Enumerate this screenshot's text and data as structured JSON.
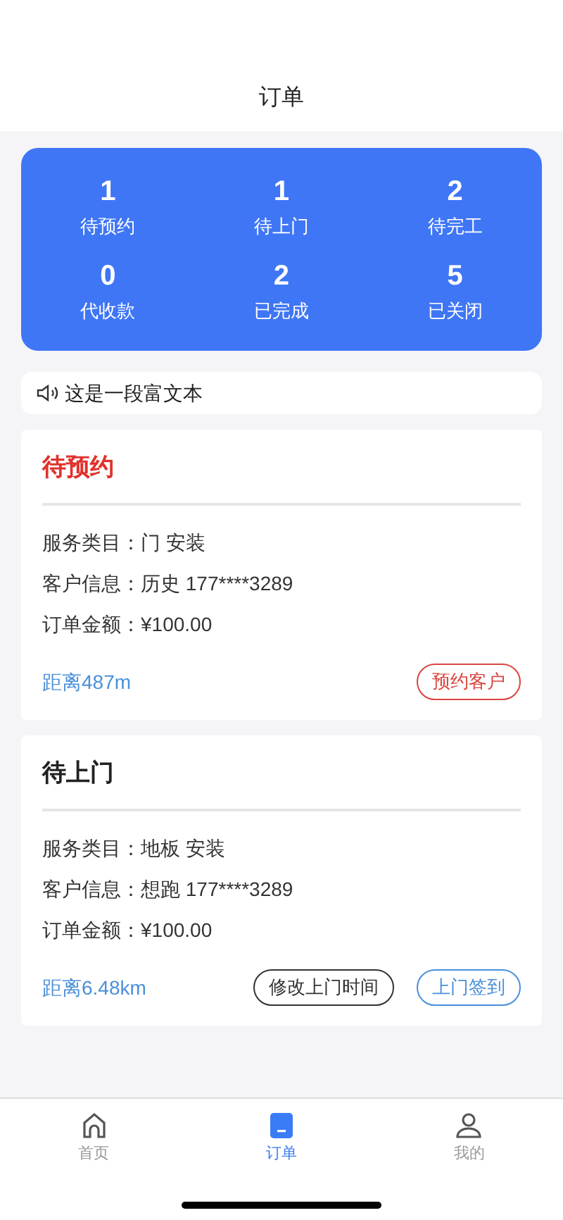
{
  "header": {
    "title": "订单"
  },
  "stats": [
    {
      "count": "1",
      "label": "待预约"
    },
    {
      "count": "1",
      "label": "待上门"
    },
    {
      "count": "2",
      "label": "待完工"
    },
    {
      "count": "0",
      "label": "代收款"
    },
    {
      "count": "2",
      "label": "已完成"
    },
    {
      "count": "5",
      "label": "已关闭"
    }
  ],
  "notice": {
    "text": "这是一段富文本"
  },
  "orders": [
    {
      "status": "待预约",
      "color": "#e0322c",
      "fields": [
        {
          "label": "服务类目：",
          "value": "门 安装"
        },
        {
          "label": "客户信息：",
          "value": "历史 177****3289"
        },
        {
          "label": "订单金额：",
          "value": "¥100.00"
        }
      ],
      "distance": "距离487m",
      "actions": [
        {
          "label": "预约客户",
          "color": "#d9453f"
        }
      ]
    },
    {
      "status": "待上门",
      "color": "#222222",
      "fields": [
        {
          "label": "服务类目：",
          "value": "地板 安装"
        },
        {
          "label": "客户信息：",
          "value": "想跑 177****3289"
        },
        {
          "label": "订单金额：",
          "value": "¥100.00"
        }
      ],
      "distance": "距离6.48km",
      "actions": [
        {
          "label": "修改上门时间",
          "color": "#333333"
        },
        {
          "label": "上门签到",
          "color": "#4a90d9"
        }
      ]
    }
  ],
  "tabbar": [
    {
      "label": "首页",
      "kind": "home",
      "selected": false
    },
    {
      "label": "订单",
      "kind": "orders",
      "selected": true
    },
    {
      "label": "我的",
      "kind": "profile",
      "selected": false
    }
  ]
}
